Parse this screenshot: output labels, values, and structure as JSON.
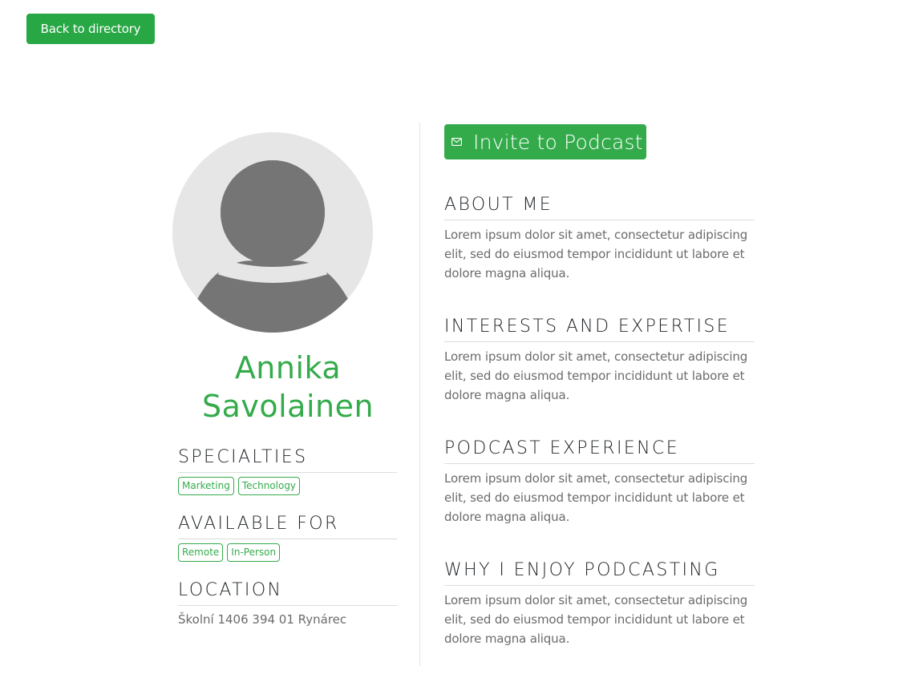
{
  "nav": {
    "back_label": "Back to directory"
  },
  "profile": {
    "first_name": "Annika",
    "last_name": "Savolainen",
    "specialties_title": "SPECIALTIES",
    "specialties": [
      "Marketing",
      "Technology"
    ],
    "available_title": "AVAILABLE FOR",
    "available": [
      "Remote",
      "In-Person"
    ],
    "location_title": "LOCATION",
    "location": "Školní 1406 394 01 Rynárec"
  },
  "actions": {
    "invite_label": "Invite to Podcast",
    "invite_icon": "envelope-icon"
  },
  "sections": [
    {
      "title": "ABOUT ME",
      "body": "Lorem ipsum dolor sit amet, consectetur adipiscing elit, sed do eiusmod tempor incididunt ut labore et dolore magna aliqua."
    },
    {
      "title": "INTERESTS AND EXPERTISE",
      "body": "Lorem ipsum dolor sit amet, consectetur adipiscing elit, sed do eiusmod tempor incididunt ut labore et dolore magna aliqua."
    },
    {
      "title": "PODCAST EXPERIENCE",
      "body": "Lorem ipsum dolor sit amet, consectetur adipiscing elit, sed do eiusmod tempor incididunt ut labore et dolore magna aliqua."
    },
    {
      "title": "WHY I ENJOY PODCASTING",
      "body": "Lorem ipsum dolor sit amet, consectetur adipiscing elit, sed do eiusmod tempor incididunt ut labore et dolore magna aliqua."
    }
  ],
  "colors": {
    "primary_green": "#28a745",
    "accent_green": "#34ab4b",
    "avatar_bg": "#e6e6e6",
    "avatar_fg": "#757575"
  }
}
